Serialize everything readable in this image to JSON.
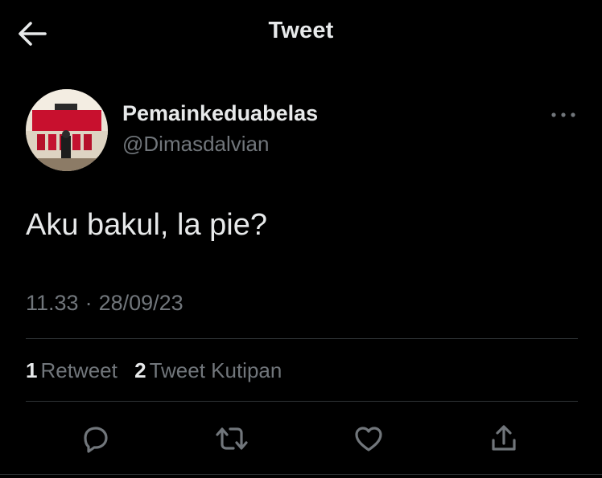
{
  "header": {
    "title": "Tweet",
    "back_icon": "arrow-left-icon"
  },
  "tweet": {
    "author": {
      "display_name": "Pemainkeduabelas",
      "handle": "@Dimasdalvian"
    },
    "more_icon": "more-horizontal-icon",
    "text": "Aku bakul, la pie?",
    "time": "11.33",
    "separator": "·",
    "date": "28/09/23",
    "stats": {
      "retweets_count": "1",
      "retweets_label": "Retweet",
      "quotes_count": "2",
      "quotes_label": "Tweet Kutipan"
    },
    "actions": [
      {
        "icon": "reply-icon"
      },
      {
        "icon": "retweet-icon"
      },
      {
        "icon": "like-icon"
      },
      {
        "icon": "share-icon"
      }
    ]
  },
  "colors": {
    "background": "#000000",
    "text_primary": "#e7e9ea",
    "text_secondary": "#71767b",
    "divider": "#2f3336"
  }
}
